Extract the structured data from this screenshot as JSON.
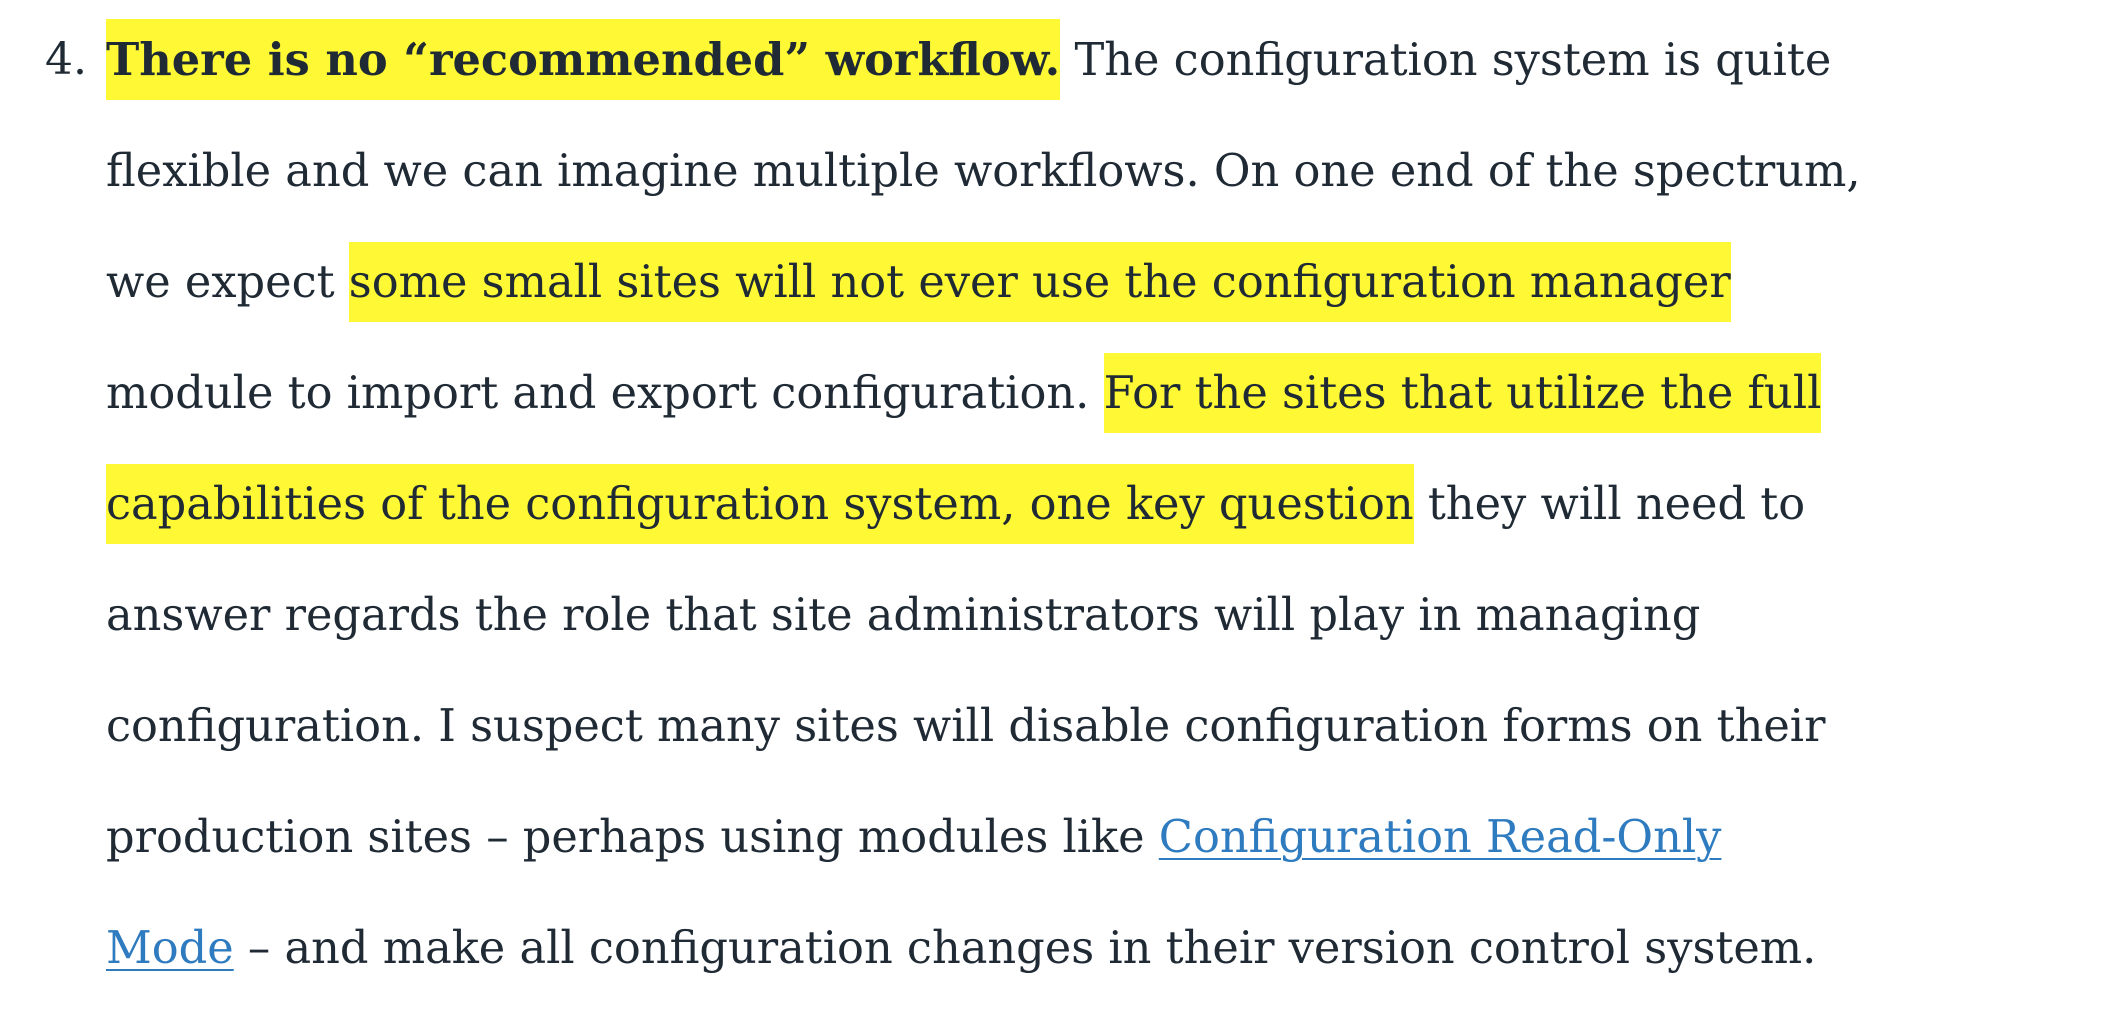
{
  "list": {
    "item_number": "4.",
    "heading": "There is no “recommended” workflow.",
    "lines": [
      {
        "l1_rest": " The configuration system is quite"
      }
    ],
    "l2": "flexible and we can imagine multiple workflows. On one end of the spectrum,",
    "l3_pre": "we expect ",
    "l3_hl": "some small sites will not ever use the configuration manager",
    "l4_pre": "module to import and export configuration. ",
    "l4_hl": "For the sites that utilize the full",
    "l5_hl": "capabilities of the configuration system, one key question",
    "l5_post": " they will need to",
    "l6": "answer regards the role that site administrators will play in managing",
    "l7": "configuration. I suspect many sites will disable configuration forms on their",
    "l8_pre": "production sites – perhaps using modules like ",
    "link_l8": "Configuration Read-Only",
    "link_l9": "Mode",
    "l9_post": " – and make all configuration changes in their version control system."
  },
  "colors": {
    "text": "#1f2a35",
    "highlight": "#fef934",
    "link": "#2e7bbf",
    "background": "#ffffff"
  }
}
